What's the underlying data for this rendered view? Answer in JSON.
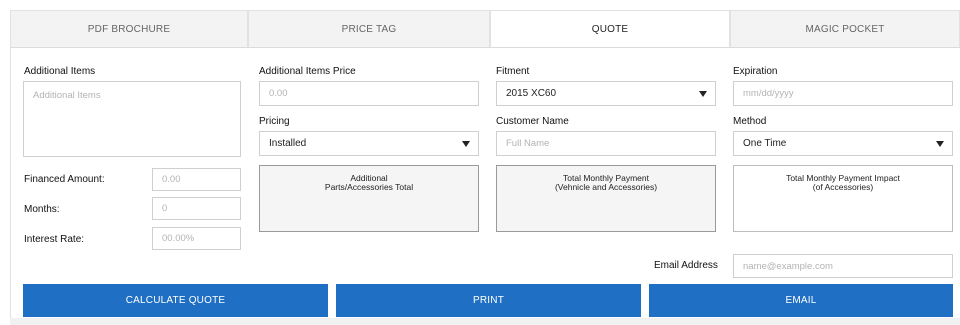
{
  "tabs": [
    {
      "label": "PDF BROCHURE",
      "active": false
    },
    {
      "label": "PRICE TAG",
      "active": false
    },
    {
      "label": "QUOTE",
      "active": true
    },
    {
      "label": "MAGIC POCKET",
      "active": false
    }
  ],
  "additional_items": {
    "label": "Additional Items",
    "placeholder": "Additional Items"
  },
  "additional_items_price": {
    "label": "Additional Items Price",
    "placeholder": "0.00"
  },
  "fitment": {
    "label": "Fitment",
    "value": "2015 XC60"
  },
  "expiration": {
    "label": "Expiration",
    "placeholder": "mm/dd/yyyy"
  },
  "pricing": {
    "label": "Pricing",
    "value": "Installed"
  },
  "customer_name": {
    "label": "Customer Name",
    "placeholder": "Full Name"
  },
  "method": {
    "label": "Method",
    "value": "One Time"
  },
  "financed_amount": {
    "label": "Financed Amount:",
    "placeholder": "0.00"
  },
  "months": {
    "label": "Months:",
    "placeholder": "0"
  },
  "interest_rate": {
    "label": "Interest Rate:",
    "placeholder": "00.00%"
  },
  "totals": {
    "parts_line1": "Additional",
    "parts_line2": "Parts/Accessories Total",
    "monthly_line1": "Total Monthly Payment",
    "monthly_line2": "(Vehnicle and Accessories)",
    "impact_line1": "Total Monthly Payment Impact",
    "impact_line2": "(of Accessories)"
  },
  "email": {
    "label": "Email Address",
    "placeholder": "name@example.com"
  },
  "buttons": {
    "calculate": "CALCULATE QUOTE",
    "print": "PRINT",
    "email": "EMAIL"
  },
  "colors": {
    "accent": "#1f6fc5",
    "tab_inactive": "#f3f3f3"
  }
}
